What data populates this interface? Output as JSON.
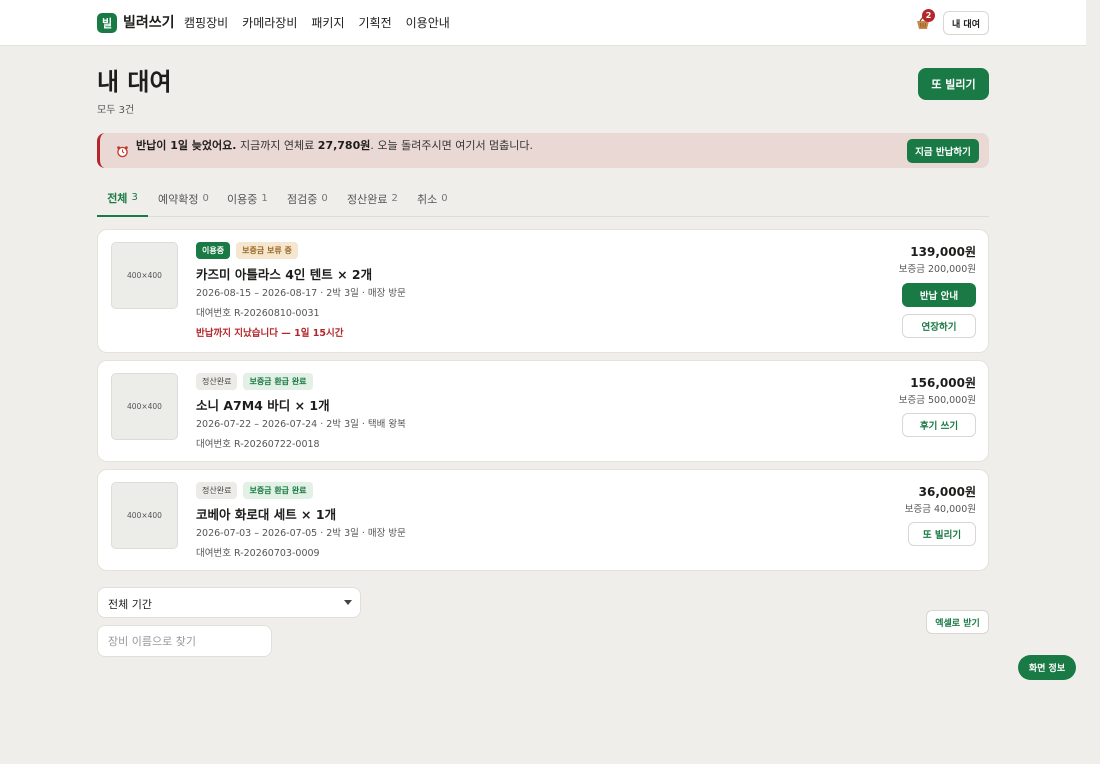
{
  "header": {
    "logo_mark": "빌",
    "logo_text": "빌려쓰기",
    "nav": [
      "캠핑장비",
      "카메라장비",
      "패키지",
      "기획전",
      "이용안내"
    ],
    "cart_icon": "basket-icon",
    "cart_count": "2",
    "my_rental_label": "내 대여"
  },
  "page": {
    "title": "내 대여",
    "count": "모두 3건",
    "rent_again_label": "또 빌리기"
  },
  "alert": {
    "icon": "alarm-clock-icon",
    "bold_1": "반납이 1일 늦었어요.",
    "text_1": " 지금까지 연체료 ",
    "bold_2": "27,780원",
    "text_2": ". 오늘 돌려주시면 여기서 멈춥니다.",
    "button": "지금 반납하기",
    "accent": "#b3262b"
  },
  "tabs": [
    {
      "label": "전체",
      "count": "3",
      "active": true
    },
    {
      "label": "예약확정",
      "count": "0"
    },
    {
      "label": "이용중",
      "count": "1"
    },
    {
      "label": "점검중",
      "count": "0"
    },
    {
      "label": "정산완료",
      "count": "2"
    },
    {
      "label": "취소",
      "count": "0"
    }
  ],
  "rentals": [
    {
      "thumb": "400×400",
      "badges": [
        "이용중",
        "보증금 보류 중"
      ],
      "title": "카즈미 아틀라스 4인 텐트 × 2개",
      "dates": "2026-08-15 – 2026-08-17 · 2박 3일 · 매장 방문",
      "ref": "대여번호 R-20260810-0031",
      "warning": "반납까지 지났습니다 — 1일 15시간",
      "price": "139,000원",
      "deposit": "보증금 200,000원",
      "actions": [
        "반납 안내",
        "연장하기"
      ]
    },
    {
      "thumb": "400×400",
      "badges": [
        "정산완료",
        "보증금 환급 완료"
      ],
      "title": "소니 A7M4 바디 × 1개",
      "dates": "2026-07-22 – 2026-07-24 · 2박 3일 · 택배 왕복",
      "ref": "대여번호 R-20260722-0018",
      "price": "156,000원",
      "deposit": "보증금 500,000원",
      "actions": [
        "후기 쓰기"
      ]
    },
    {
      "thumb": "400×400",
      "badges": [
        "정산완료",
        "보증금 환급 완료"
      ],
      "title": "코베아 화로대 세트 × 1개",
      "dates": "2026-07-03 – 2026-07-05 · 2박 3일 · 매장 방문",
      "ref": "대여번호 R-20260703-0009",
      "price": "36,000원",
      "deposit": "보증금 40,000원",
      "actions": [
        "또 빌리기"
      ]
    }
  ],
  "filters": {
    "period_value": "전체 기간",
    "search_placeholder": "장비 이름으로 찾기",
    "excel_label": "엑셀로 받기"
  },
  "screen_info_label": "화면 정보",
  "colors": {
    "brand": "#1a7a45",
    "background": "#efeeea",
    "danger": "#b3262b"
  }
}
